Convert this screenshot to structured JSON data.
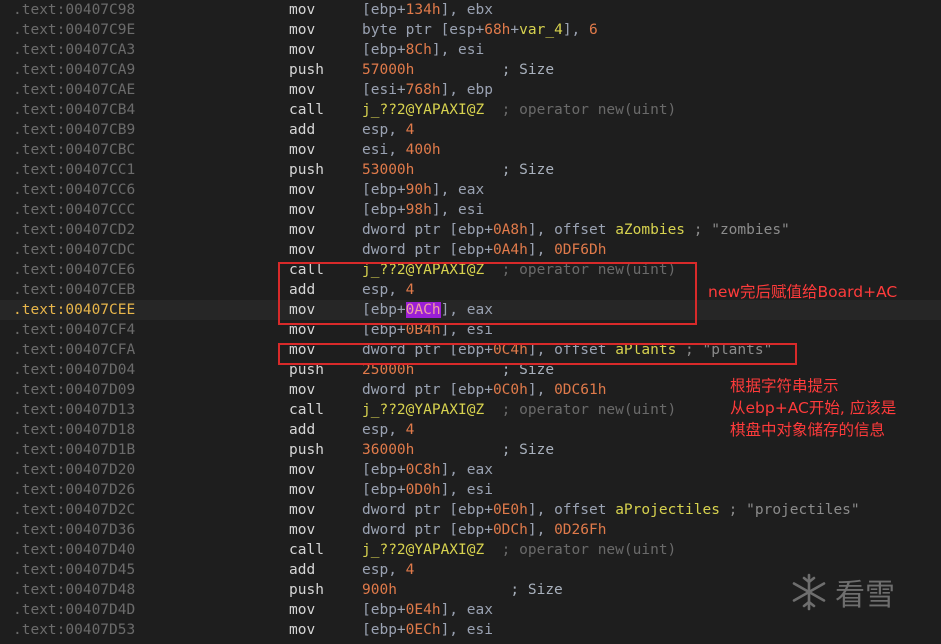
{
  "rows": [
    {
      "addr": ".text:00407C98",
      "mn": "mov",
      "ops": [
        {
          "t": "[ebp+"
        },
        {
          "t": "134h",
          "c": "num"
        },
        {
          "t": "], ebx"
        }
      ]
    },
    {
      "addr": ".text:00407C9E",
      "mn": "mov",
      "ops": [
        {
          "t": "byte ptr [esp+"
        },
        {
          "t": "68h",
          "c": "num"
        },
        {
          "t": "+"
        },
        {
          "t": "var_4",
          "c": "sym"
        },
        {
          "t": "], "
        },
        {
          "t": "6",
          "c": "num"
        }
      ]
    },
    {
      "addr": ".text:00407CA3",
      "mn": "mov",
      "ops": [
        {
          "t": "[ebp+"
        },
        {
          "t": "8Ch",
          "c": "num"
        },
        {
          "t": "], esi"
        }
      ]
    },
    {
      "addr": ".text:00407CA9",
      "mn": "push",
      "ops": [
        {
          "t": "57000h",
          "c": "num"
        },
        {
          "t": "          ; Size",
          "c": "sz"
        }
      ]
    },
    {
      "addr": ".text:00407CAE",
      "mn": "mov",
      "ops": [
        {
          "t": "[esi+"
        },
        {
          "t": "768h",
          "c": "num"
        },
        {
          "t": "], ebp"
        }
      ]
    },
    {
      "addr": ".text:00407CB4",
      "mn": "call",
      "ops": [
        {
          "t": "j_??2@YAPAXI@Z",
          "c": "sym"
        },
        {
          "t": "  ; operator new(uint)",
          "c": "cmt"
        }
      ]
    },
    {
      "addr": ".text:00407CB9",
      "mn": "add",
      "ops": [
        {
          "t": "esp, "
        },
        {
          "t": "4",
          "c": "num"
        }
      ]
    },
    {
      "addr": ".text:00407CBC",
      "mn": "mov",
      "ops": [
        {
          "t": "esi, "
        },
        {
          "t": "400h",
          "c": "num"
        }
      ]
    },
    {
      "addr": ".text:00407CC1",
      "mn": "push",
      "ops": [
        {
          "t": "53000h",
          "c": "num"
        },
        {
          "t": "          ; Size",
          "c": "sz"
        }
      ]
    },
    {
      "addr": ".text:00407CC6",
      "mn": "mov",
      "ops": [
        {
          "t": "[ebp+"
        },
        {
          "t": "90h",
          "c": "num"
        },
        {
          "t": "], eax"
        }
      ]
    },
    {
      "addr": ".text:00407CCC",
      "mn": "mov",
      "ops": [
        {
          "t": "[ebp+"
        },
        {
          "t": "98h",
          "c": "num"
        },
        {
          "t": "], esi"
        }
      ]
    },
    {
      "addr": ".text:00407CD2",
      "mn": "mov",
      "ops": [
        {
          "t": "dword ptr [ebp+"
        },
        {
          "t": "0A8h",
          "c": "num"
        },
        {
          "t": "], offset "
        },
        {
          "t": "aZombies",
          "c": "sym"
        },
        {
          "t": " ; \"zombies\"",
          "c": "str"
        }
      ]
    },
    {
      "addr": ".text:00407CDC",
      "mn": "mov",
      "ops": [
        {
          "t": "dword ptr [ebp+"
        },
        {
          "t": "0A4h",
          "c": "num"
        },
        {
          "t": "], "
        },
        {
          "t": "0DF6Dh",
          "c": "num"
        }
      ]
    },
    {
      "addr": ".text:00407CE6",
      "mn": "call",
      "ops": [
        {
          "t": "j_??2@YAPAXI@Z",
          "c": "sym"
        },
        {
          "t": "  ; operator new(uint)",
          "c": "cmt"
        }
      ]
    },
    {
      "addr": ".text:00407CEB",
      "mn": "add",
      "ops": [
        {
          "t": "esp, "
        },
        {
          "t": "4",
          "c": "num"
        }
      ]
    },
    {
      "addr": ".text:00407CEE",
      "mn": "mov",
      "current": true,
      "ops": [
        {
          "t": "[ebp+"
        },
        {
          "t": "0ACh",
          "c": "num hl"
        },
        {
          "t": "], eax"
        }
      ]
    },
    {
      "addr": ".text:00407CF4",
      "mn": "mov",
      "ops": [
        {
          "t": "[ebp+"
        },
        {
          "t": "0B4h",
          "c": "num"
        },
        {
          "t": "], esi"
        }
      ]
    },
    {
      "addr": ".text:00407CFA",
      "mn": "mov",
      "ops": [
        {
          "t": "dword ptr [ebp+"
        },
        {
          "t": "0C4h",
          "c": "num"
        },
        {
          "t": "], offset "
        },
        {
          "t": "aPlants",
          "c": "sym"
        },
        {
          "t": " ; \"plants\"",
          "c": "str"
        }
      ]
    },
    {
      "addr": ".text:00407D04",
      "mn": "push",
      "ops": [
        {
          "t": "25000h",
          "c": "num"
        },
        {
          "t": "          ; Size",
          "c": "sz"
        }
      ]
    },
    {
      "addr": ".text:00407D09",
      "mn": "mov",
      "ops": [
        {
          "t": "dword ptr [ebp+"
        },
        {
          "t": "0C0h",
          "c": "num"
        },
        {
          "t": "], "
        },
        {
          "t": "0DC61h",
          "c": "num"
        }
      ]
    },
    {
      "addr": ".text:00407D13",
      "mn": "call",
      "ops": [
        {
          "t": "j_??2@YAPAXI@Z",
          "c": "sym"
        },
        {
          "t": "  ; operator new(uint)",
          "c": "cmt"
        }
      ]
    },
    {
      "addr": ".text:00407D18",
      "mn": "add",
      "ops": [
        {
          "t": "esp, "
        },
        {
          "t": "4",
          "c": "num"
        }
      ]
    },
    {
      "addr": ".text:00407D1B",
      "mn": "push",
      "ops": [
        {
          "t": "36000h",
          "c": "num"
        },
        {
          "t": "          ; Size",
          "c": "sz"
        }
      ]
    },
    {
      "addr": ".text:00407D20",
      "mn": "mov",
      "ops": [
        {
          "t": "[ebp+"
        },
        {
          "t": "0C8h",
          "c": "num"
        },
        {
          "t": "], eax"
        }
      ]
    },
    {
      "addr": ".text:00407D26",
      "mn": "mov",
      "ops": [
        {
          "t": "[ebp+"
        },
        {
          "t": "0D0h",
          "c": "num"
        },
        {
          "t": "], esi"
        }
      ]
    },
    {
      "addr": ".text:00407D2C",
      "mn": "mov",
      "ops": [
        {
          "t": "dword ptr [ebp+"
        },
        {
          "t": "0E0h",
          "c": "num"
        },
        {
          "t": "], offset "
        },
        {
          "t": "aProjectiles",
          "c": "sym"
        },
        {
          "t": " ; \"projectiles\"",
          "c": "str"
        }
      ]
    },
    {
      "addr": ".text:00407D36",
      "mn": "mov",
      "ops": [
        {
          "t": "dword ptr [ebp+"
        },
        {
          "t": "0DCh",
          "c": "num"
        },
        {
          "t": "], "
        },
        {
          "t": "0D26Fh",
          "c": "num"
        }
      ]
    },
    {
      "addr": ".text:00407D40",
      "mn": "call",
      "ops": [
        {
          "t": "j_??2@YAPAXI@Z",
          "c": "sym"
        },
        {
          "t": "  ; operator new(uint)",
          "c": "cmt"
        }
      ]
    },
    {
      "addr": ".text:00407D45",
      "mn": "add",
      "ops": [
        {
          "t": "esp, "
        },
        {
          "t": "4",
          "c": "num"
        }
      ]
    },
    {
      "addr": ".text:00407D48",
      "mn": "push",
      "ops": [
        {
          "t": "900h",
          "c": "num"
        },
        {
          "t": "             ; Size",
          "c": "sz"
        }
      ]
    },
    {
      "addr": ".text:00407D4D",
      "mn": "mov",
      "ops": [
        {
          "t": "[ebp+"
        },
        {
          "t": "0E4h",
          "c": "num"
        },
        {
          "t": "], eax"
        }
      ]
    },
    {
      "addr": ".text:00407D53",
      "mn": "mov",
      "ops": [
        {
          "t": "[ebp+"
        },
        {
          "t": "0ECh",
          "c": "num"
        },
        {
          "t": "], esi"
        }
      ]
    }
  ],
  "annotations": {
    "note1": "new完后赋值给Board+AC",
    "note2": "根据字符串提示\n从ebp+AC开始, 应该是\n棋盘中对象储存的信息"
  },
  "watermark": {
    "text": "看雪",
    "icon": "snowflake-icon"
  },
  "colors": {
    "background": "#1e1e1e",
    "address": "#6b6b6b",
    "current_address": "#e8b64b",
    "number": "#e07a4a",
    "symbol": "#d7d24f",
    "highlight": "#9b1fd6",
    "annotation": "#ff3b3b"
  }
}
